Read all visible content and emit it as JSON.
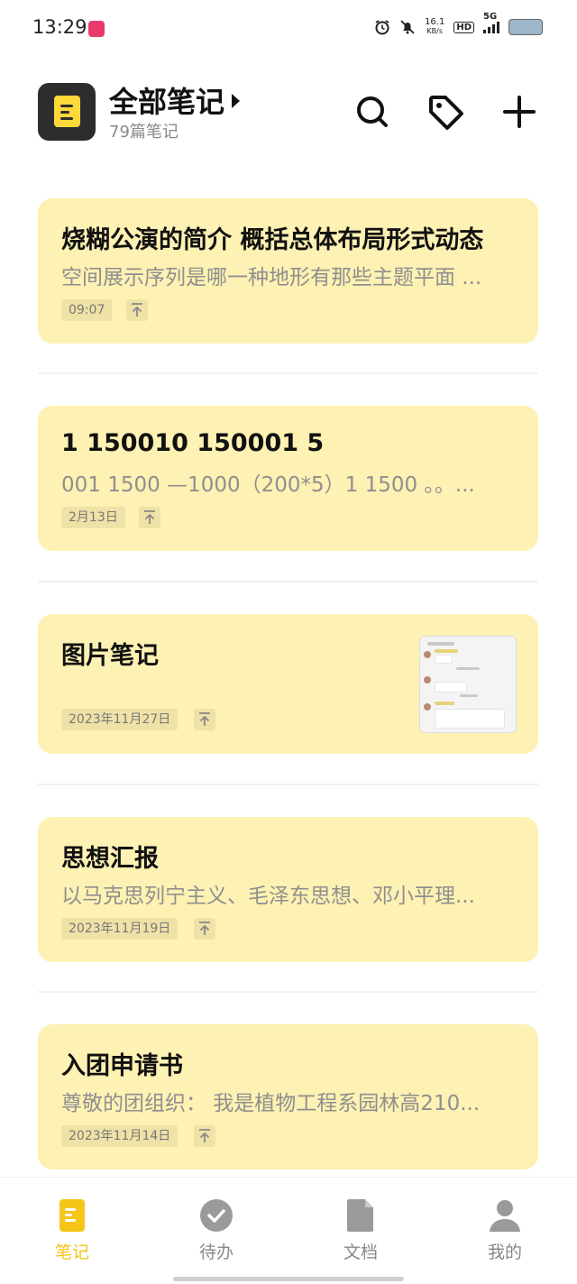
{
  "status_bar": {
    "time": "13:29",
    "net_speed_value": "16.1",
    "net_speed_unit": "KB/s",
    "hd": "HD",
    "network": "5G"
  },
  "header": {
    "title": "全部笔记",
    "count_text": "79篇笔记",
    "icons": [
      "search-icon",
      "tag-icon",
      "plus-icon"
    ]
  },
  "notes": [
    {
      "title": "烧糊公演的简介 概括总体布局形式动态",
      "preview": "空间展示序列是哪一种地形有那些主题平面 ...",
      "date": "09:07"
    },
    {
      "title": "1 150010 150001  5",
      "preview": "001  1500    —1000（200*5）1   1500   。。...",
      "date": "2月13日"
    },
    {
      "title": "图片笔记",
      "preview": "",
      "date": "2023年11月27日"
    },
    {
      "title": "思想汇报",
      "preview": "以马克思列宁主义、毛泽东思想、邓小平理...",
      "date": "2023年11月19日"
    },
    {
      "title": "入团申请书",
      "preview": "尊敬的团组织：  我是植物工程系园林高210...",
      "date": "2023年11月14日"
    }
  ],
  "bottom_nav": [
    {
      "label": "笔记",
      "icon": "note-icon",
      "active": true
    },
    {
      "label": "待办",
      "icon": "check-circle-icon",
      "active": false
    },
    {
      "label": "文档",
      "icon": "document-icon",
      "active": false
    },
    {
      "label": "我的",
      "icon": "person-icon",
      "active": false
    }
  ],
  "colors": {
    "card_bg": "#fdf1b3",
    "accent": "#f5c518",
    "logo_bg": "#2d2d2d"
  }
}
